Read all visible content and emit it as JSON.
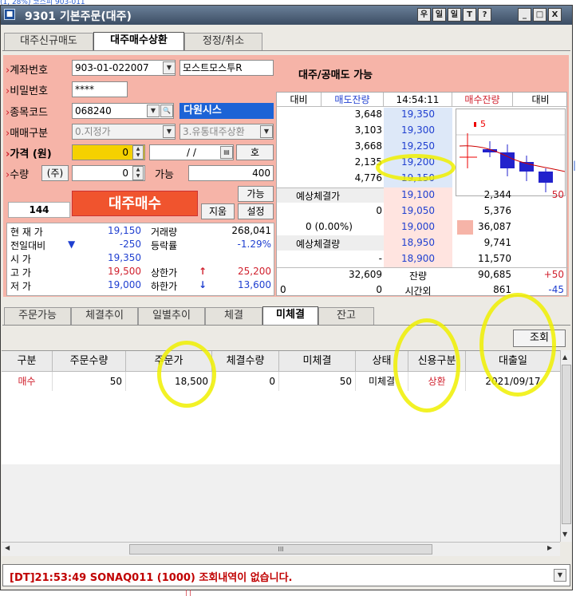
{
  "top_fragment": "(1, 28%)   코스피 903-011",
  "window": {
    "title": "9301 기본주문(대주)",
    "title_buttons": [
      "우",
      "일",
      "일",
      "T",
      "?",
      "_",
      "□",
      "X"
    ]
  },
  "main_tabs": [
    {
      "label": "대주신규매도",
      "active": false
    },
    {
      "label": "대주매수상환",
      "active": true
    },
    {
      "label": "정정/취소",
      "active": false
    }
  ],
  "form": {
    "account_label": "계좌번호",
    "account_value": "903-01-022007",
    "account_name": "모스트모스투R",
    "password_label": "비밀번호",
    "password_value": "****",
    "code_label": "종목코드",
    "code_value": "068240",
    "stock_name": "다원시스",
    "trade_type_label": "매매구분",
    "trade_type_value": "0.지정가",
    "credit_type_value": "3.유통대주상환",
    "price_label": "가격",
    "price_unit": "(원)",
    "price_value": "0",
    "date_value": "/ /",
    "ho_label": "호",
    "qty_label": "수량",
    "qty_unit": "(주)",
    "qty_value": "0",
    "possible_label": "가능",
    "possible_value": "400",
    "possible_button": "가능",
    "clear_button": "지움",
    "settings_button": "설정",
    "count_value": "144",
    "buy_button": "대주매수"
  },
  "price_info": {
    "rows": [
      {
        "l1": "현 재 가",
        "v1": "19,150",
        "l2": "거래량",
        "v2": "268,041"
      },
      {
        "l1": "전일대비",
        "arrow": "▼",
        "v1": "-250",
        "l2": "등락률",
        "v2": "-1.29%"
      },
      {
        "l1": "시    가",
        "v1": "19,350",
        "l2": "",
        "v2": ""
      },
      {
        "l1": "고    가",
        "v1": "19,500",
        "l2": "상한가",
        "v2": "25,200",
        "arrow2": "↑"
      },
      {
        "l1": "저    가",
        "v1": "19,000",
        "l2": "하한가",
        "v2": "13,600",
        "arrow2": "↓"
      }
    ]
  },
  "orderbook": {
    "title": "대주/공매도 가능",
    "headers": [
      "대비",
      "매도잔량",
      "14:54:11",
      "매수잔량",
      "대비"
    ],
    "asks": [
      {
        "qty": "3,648",
        "price": "19,350"
      },
      {
        "qty": "3,103",
        "price": "19,300"
      },
      {
        "qty": "3,668",
        "price": "19,250"
      },
      {
        "qty": "2,135",
        "price": "19,200"
      },
      {
        "qty": "4,776",
        "price": "19,150"
      }
    ],
    "bids": [
      {
        "price": "19,100",
        "qty": "2,344",
        "diff": "50"
      },
      {
        "price": "19,050",
        "qty": "5,376",
        "diff": ""
      },
      {
        "price": "19,000",
        "qty": "36,087",
        "diff": ""
      },
      {
        "price": "18,950",
        "qty": "9,741",
        "diff": ""
      },
      {
        "price": "18,900",
        "qty": "11,570",
        "diff": ""
      }
    ],
    "expected_price_label": "예상체결가",
    "expected_price_value": "0",
    "expected_change": "0  (0.00%)",
    "expected_qty_label": "예상체결량",
    "expected_qty_value": "-",
    "total_ask": "32,609",
    "remaining_label": "잔량",
    "total_bid": "90,685",
    "total_bid_diff": "+50",
    "after_left": "0",
    "after_mid": "0",
    "after_label": "시간외",
    "after_qty": "861",
    "after_diff": "-45",
    "chart_marker": "5"
  },
  "sub_tabs": [
    {
      "label": "주문가능",
      "active": false
    },
    {
      "label": "체결추이",
      "active": false
    },
    {
      "label": "일별추이",
      "active": false
    },
    {
      "label": "체결",
      "active": false
    },
    {
      "label": "미체결",
      "active": true
    },
    {
      "label": "잔고",
      "active": false
    }
  ],
  "query_button": "조회",
  "grid": {
    "headers": [
      "구분",
      "주문수량",
      "주문가",
      "체결수량",
      "미체결",
      "상태",
      "신용구분",
      "대출일"
    ],
    "rows": [
      {
        "type": "매수",
        "order_qty": "50",
        "order_price": "18,500",
        "filled_qty": "0",
        "unfilled": "50",
        "status": "미체결",
        "credit": "상환",
        "loan_date": "2021/09/17"
      }
    ],
    "hscroll_thumb": "III"
  },
  "status_message": "[DT]21:53:49 SONAQ011 (1000) 조회내역이 없습니다.",
  "colors": {
    "accent_red": "#d0202d",
    "highlight": "#f0f000",
    "blue_value": "#1f3fd0",
    "panel_pink": "#f6b4a8"
  }
}
